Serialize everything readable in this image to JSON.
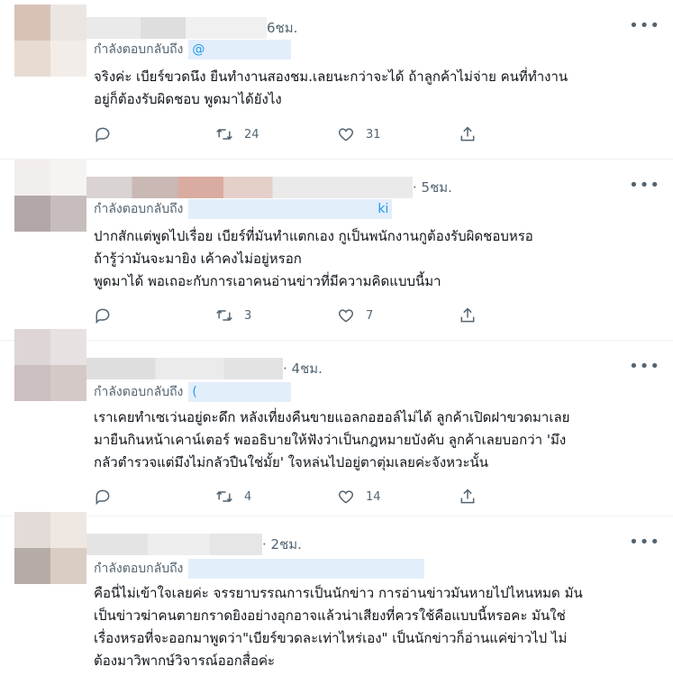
{
  "colors": {
    "text": "#0f1419",
    "muted": "#536471",
    "link": "#1d9bf0",
    "divider": "#eff3f4"
  },
  "tweets": [
    {
      "time": "6ชม.",
      "replying_label": "กำลังตอบกลับถึง",
      "handle": "@",
      "lines": [
        "จริงค่ะ เบียร์ขวดนึง ยืนทำงานสองชม.เลยนะกว่าจะได้ ถ้าลูกค้าไม่จ่าย คนที่ทำงาน",
        "อยู่ก็ต้องรับผิดชอบ พูดมาได้ยังไง"
      ],
      "retweets": "24",
      "likes": "31"
    },
    {
      "time": "· 5ชม.",
      "replying_label": "กำลังตอบกลับถึง",
      "handle": "ki",
      "lines": [
        "ปากสักแต่พูดไปเรื่อย เบียร์ที่มันทำแตกเอง กูเป็นพนักงานกูต้องรับผิดชอบหรอ",
        "ถ้ารู้ว่ามันจะมายิง เค้าคงไม่อยู่หรอก",
        "พูดมาได้ พอเถอะกับการเอาคนอ่านข่าวที่มีความคิดแบบนี้มา"
      ],
      "retweets": "3",
      "likes": "7"
    },
    {
      "time": "· 4ชม.",
      "replying_label": "กำลังตอบกลับถึง",
      "handle": "(",
      "lines": [
        "เราเคยทำเซเว่นอยู่ดะดึก หลังเที่ยงคืนขายแอลกอฮอล์ไม่ได้ ลูกค้าเปิดฝาขวดมาเลย",
        "มายืนกินหน้าเคาน์เตอร์ พออธิบายให้ฟังว่าเป็นกฎหมายบังคับ ลูกค้าเลยบอกว่า 'มึง",
        "กลัวตำรวจแต่มึงไม่กลัวปืนใช่มั้ย' ใจหล่นไปอยู่ตาตุ่มเลยค่ะจังหวะนั้น"
      ],
      "retweets": "4",
      "likes": "14"
    },
    {
      "time": "· 2ชม.",
      "replying_label": "กำลังตอบกลับถึง",
      "handle": "",
      "lines": [
        "คือนี่ไม่เข้าใจเลยค่ะ จรรยาบรรณการเป็นนักข่าว การอ่านข่าวมันหายไปไหนหมด มัน",
        "เป็นข่าวฆ่าคนตายกราดยิงอย่างอุกอาจแล้วน่าเสียงที่ควรใช้คือแบบนี้หรอคะ มันใช่",
        "เรื่องหรอที่จะออกมาพูดว่า\"เบียร์ขวดละเท่าไหร่เอง\" เป็นนักข่าวก็อ่านแค่ข่าวไป ไม่",
        "ต้องมาวิพากษ์วิจารณ์ออกสื่อค่ะ"
      ],
      "retweets": "",
      "likes": ""
    }
  ]
}
